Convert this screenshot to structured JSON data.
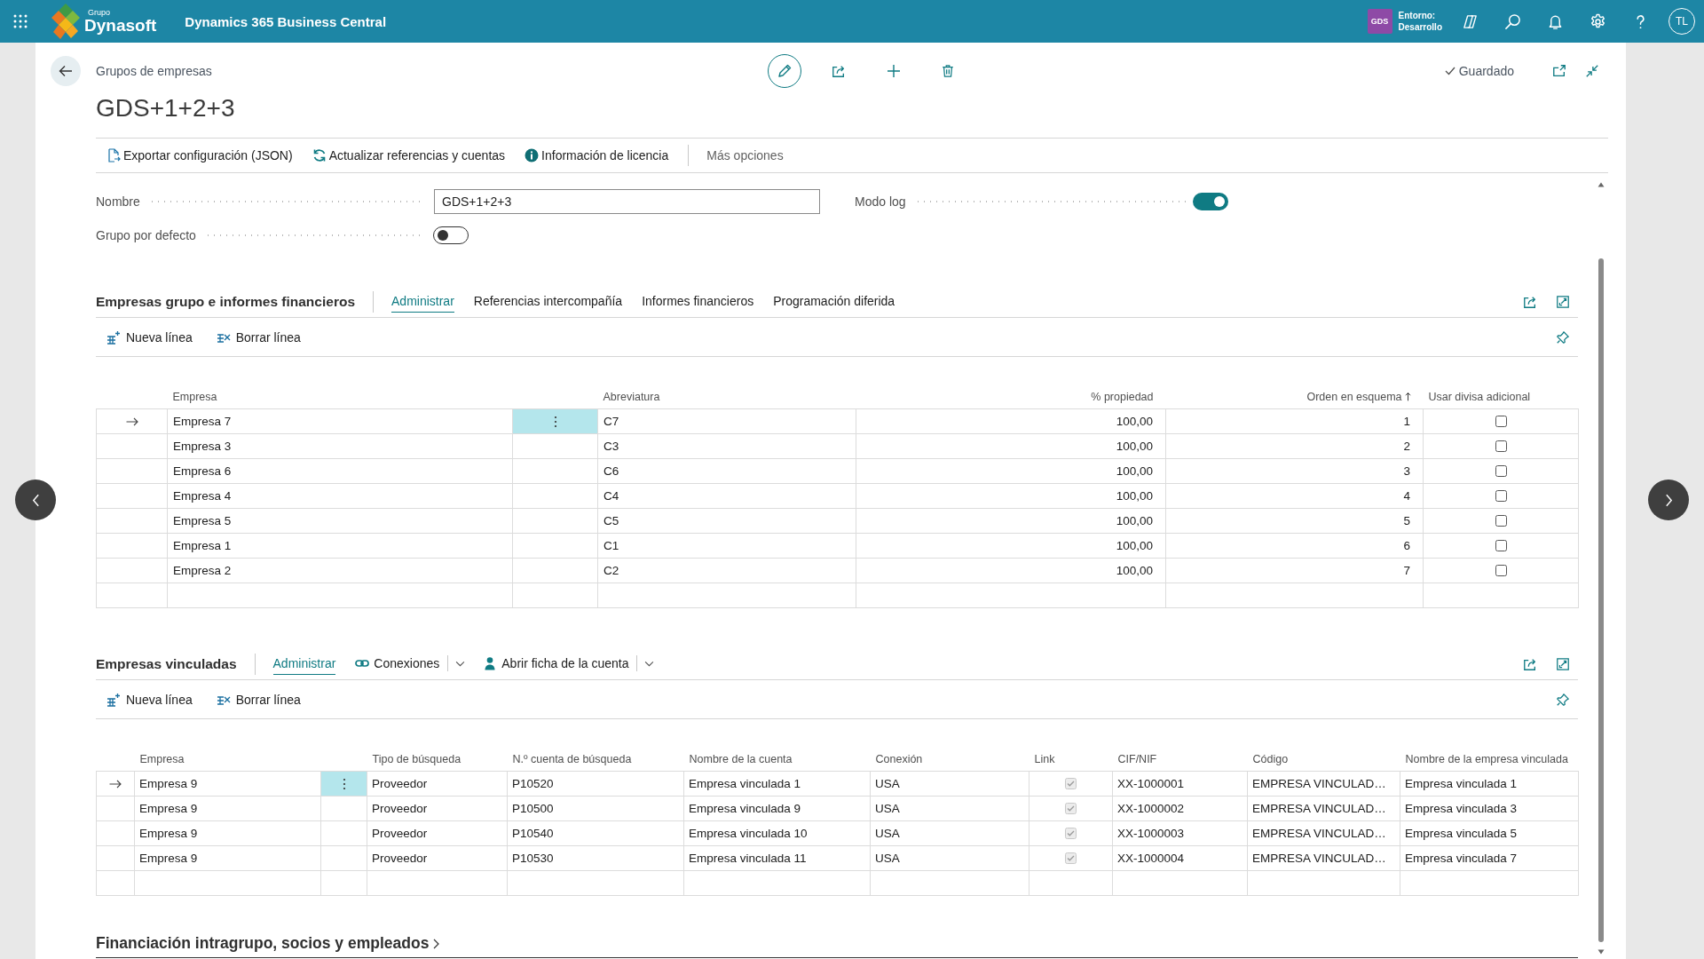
{
  "top_bar": {
    "brand_caption": "Grupo",
    "brand": "Dynasoft",
    "app_title": "Dynamics 365 Business Central",
    "environment_badge": "GDS",
    "environment_label": "Entorno:",
    "environment_name": "Desarrollo",
    "avatar": "TL"
  },
  "page": {
    "breadcrumb": "Grupos de empresas",
    "status": "Guardado",
    "title": "GDS+1+2+3"
  },
  "actions": [
    {
      "kind": "export",
      "label": "Exportar configuración (JSON)"
    },
    {
      "kind": "refresh",
      "label": "Actualizar referencias y cuentas"
    },
    {
      "kind": "info",
      "label": "Información de licencia"
    },
    {
      "kind": "more",
      "label": "Más opciones"
    }
  ],
  "fields": [
    {
      "kind": "text",
      "label": "Nombre",
      "value": "GDS+1+2+3"
    },
    {
      "kind": "toggle",
      "label": "Modo log",
      "on": true
    },
    {
      "kind": "toggle",
      "label": "Grupo por defecto",
      "on": false
    }
  ],
  "sections": [
    {
      "title": "Empresas grupo e informes financieros",
      "tabs": [
        {
          "kind": "tab",
          "label": "Administrar",
          "selected": true
        },
        {
          "kind": "tab",
          "label": "Referencias intercompañía",
          "selected": false
        },
        {
          "kind": "tab",
          "label": "Informes financieros",
          "selected": false
        },
        {
          "kind": "tab",
          "label": "Programación diferida",
          "selected": false
        }
      ],
      "toolbar": [
        {
          "kind": "new",
          "label": "Nueva línea"
        },
        {
          "kind": "delete",
          "label": "Borrar línea"
        }
      ],
      "table": {
        "columns": [
          {
            "kind": "text",
            "label": "Empresa",
            "sorted": false
          },
          {
            "kind": "text",
            "label": "Abreviatura",
            "sorted": false
          },
          {
            "kind": "number",
            "label": "% propiedad",
            "sorted": false
          },
          {
            "kind": "number",
            "label": "Orden en esquema",
            "sorted": true
          },
          {
            "kind": "check",
            "label": "Usar divisa adicional",
            "sorted": false
          }
        ],
        "rows": [
          {
            "selected": true,
            "cells": [
              "Empresa 7",
              "C7",
              "100,00",
              "1",
              false
            ]
          },
          {
            "selected": false,
            "cells": [
              "Empresa 3",
              "C3",
              "100,00",
              "2",
              false
            ]
          },
          {
            "selected": false,
            "cells": [
              "Empresa 6",
              "C6",
              "100,00",
              "3",
              false
            ]
          },
          {
            "selected": false,
            "cells": [
              "Empresa 4",
              "C4",
              "100,00",
              "4",
              false
            ]
          },
          {
            "selected": false,
            "cells": [
              "Empresa 5",
              "C5",
              "100,00",
              "5",
              false
            ]
          },
          {
            "selected": false,
            "cells": [
              "Empresa 1",
              "C1",
              "100,00",
              "6",
              false
            ]
          },
          {
            "selected": false,
            "cells": [
              "Empresa 2",
              "C2",
              "100,00",
              "7",
              false
            ]
          }
        ]
      }
    },
    {
      "title": "Empresas vinculadas",
      "tabs": [
        {
          "kind": "tab",
          "label": "Administrar",
          "selected": true
        },
        {
          "kind": "connections",
          "label": "Conexiones",
          "selected": false
        },
        {
          "kind": "account",
          "label": "Abrir ficha de la cuenta",
          "selected": false
        }
      ],
      "toolbar": [
        {
          "kind": "new",
          "label": "Nueva línea"
        },
        {
          "kind": "delete",
          "label": "Borrar línea"
        }
      ],
      "table": {
        "columns": [
          {
            "kind": "text",
            "label": "Empresa",
            "sorted": false
          },
          {
            "kind": "text",
            "label": "Tipo de búsqueda",
            "sorted": false
          },
          {
            "kind": "text",
            "label": "N.º cuenta de búsqueda",
            "sorted": false
          },
          {
            "kind": "text",
            "label": "Nombre de la cuenta",
            "sorted": false
          },
          {
            "kind": "text",
            "label": "Conexión",
            "sorted": false
          },
          {
            "kind": "readonly",
            "label": "Link",
            "sorted": false
          },
          {
            "kind": "text",
            "label": "CIF/NIF",
            "sorted": false
          },
          {
            "kind": "text",
            "label": "Código",
            "sorted": false
          },
          {
            "kind": "text",
            "label": "Nombre de la empresa vinculada",
            "sorted": false
          }
        ],
        "rows": [
          {
            "selected": true,
            "cells": [
              "Empresa 9",
              "Proveedor",
              "P10520",
              "Empresa vinculada 1",
              "USA",
              true,
              "XX-1000001",
              "EMPRESA VINCULAD…",
              "Empresa vinculada 1"
            ]
          },
          {
            "selected": false,
            "cells": [
              "Empresa 9",
              "Proveedor",
              "P10500",
              "Empresa vinculada 9",
              "USA",
              true,
              "XX-1000002",
              "EMPRESA VINCULAD…",
              "Empresa vinculada 3"
            ]
          },
          {
            "selected": false,
            "cells": [
              "Empresa 9",
              "Proveedor",
              "P10540",
              "Empresa vinculada 10",
              "USA",
              true,
              "XX-1000003",
              "EMPRESA VINCULAD…",
              "Empresa vinculada 5"
            ]
          },
          {
            "selected": false,
            "cells": [
              "Empresa 9",
              "Proveedor",
              "P10530",
              "Empresa vinculada 11",
              "USA",
              true,
              "XX-1000004",
              "EMPRESA VINCULAD…",
              "Empresa vinculada 7"
            ]
          }
        ]
      }
    }
  ],
  "collapsed_section": {
    "title": "Financiación intragrupo, socios y empleados"
  }
}
